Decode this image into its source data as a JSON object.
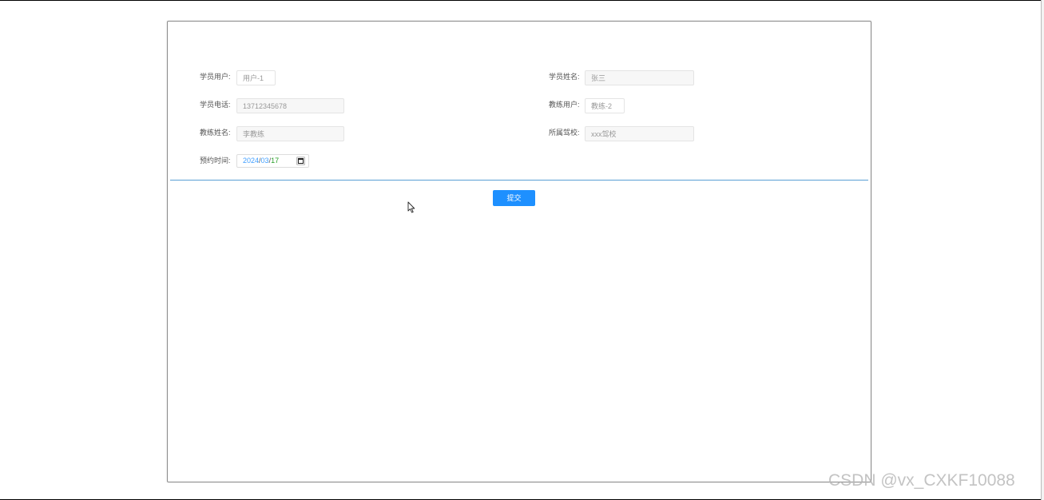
{
  "form": {
    "student_user": {
      "label": "学员用户:",
      "value": "用户-1"
    },
    "student_name": {
      "label": "学员姓名:",
      "value": "张三"
    },
    "student_phone": {
      "label": "学员电话:",
      "value": "13712345678"
    },
    "coach_user": {
      "label": "教练用户:",
      "value": "教练-2"
    },
    "coach_name": {
      "label": "教练姓名:",
      "value": "李教练"
    },
    "school": {
      "label": "所属驾校:",
      "value": "xxx驾校"
    },
    "booking_time": {
      "label": "预约时间:",
      "year": "2024",
      "month": "03",
      "day": "17",
      "separator": "/"
    }
  },
  "submit_label": "提交",
  "watermark": "CSDN @vx_CXKF10088",
  "icons": [
    "calendar-icon",
    "mouse-cursor-icon"
  ]
}
